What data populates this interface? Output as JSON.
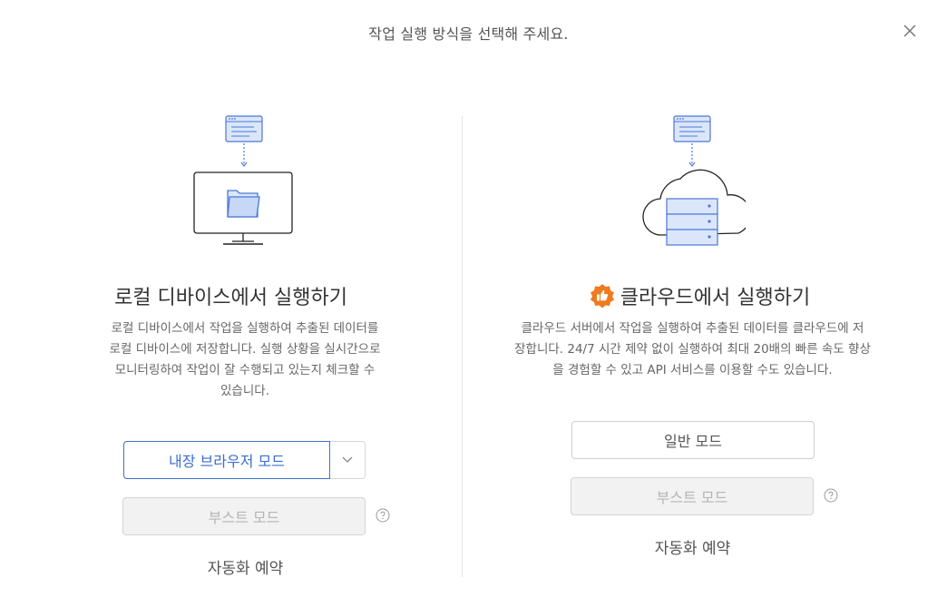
{
  "header": {
    "title": "작업 실행 방식을 선택해 주세요.",
    "close_icon": "close-icon"
  },
  "local": {
    "title": "로컬 디바이스에서 실행하기",
    "description_lines": [
      "로컬 디바이스에서 작업을 실행하여 추출된 데이터를",
      "로컬 디바이스에 저장합니다. 실행 상황을 실시간으로",
      "모니터링하여 작업이 잘 수행되고 있는지 체크할 수",
      "있습니다."
    ],
    "primary_button": "내장 브라우저 모드",
    "boost_button": "부스트 모드",
    "schedule_link": "자동화 예약",
    "illustration_icon": "monitor-folder-icon"
  },
  "cloud": {
    "title": "클라우드에서 실행하기",
    "badge_icon": "thumbs-up-badge-icon",
    "description_lines": [
      "클라우드 서버에서 작업을 실행하여 추출된 데이터를 클라우드에 저",
      "장합니다. 24/7 시간 제약 없이 실행하여 최대 20배의 빠른 속도 향상",
      "을 경험할 수 있고 API 서비스를 이용할 수도 있습니다."
    ],
    "normal_button": "일반 모드",
    "boost_button": "부스트 모드",
    "schedule_link": "자동화 예약",
    "illustration_icon": "cloud-server-icon"
  },
  "colors": {
    "accent": "#3a6ed0",
    "badge": "#f07a1e",
    "illustration_fill": "#dbe6fb",
    "illustration_stroke": "#4a78d6"
  }
}
